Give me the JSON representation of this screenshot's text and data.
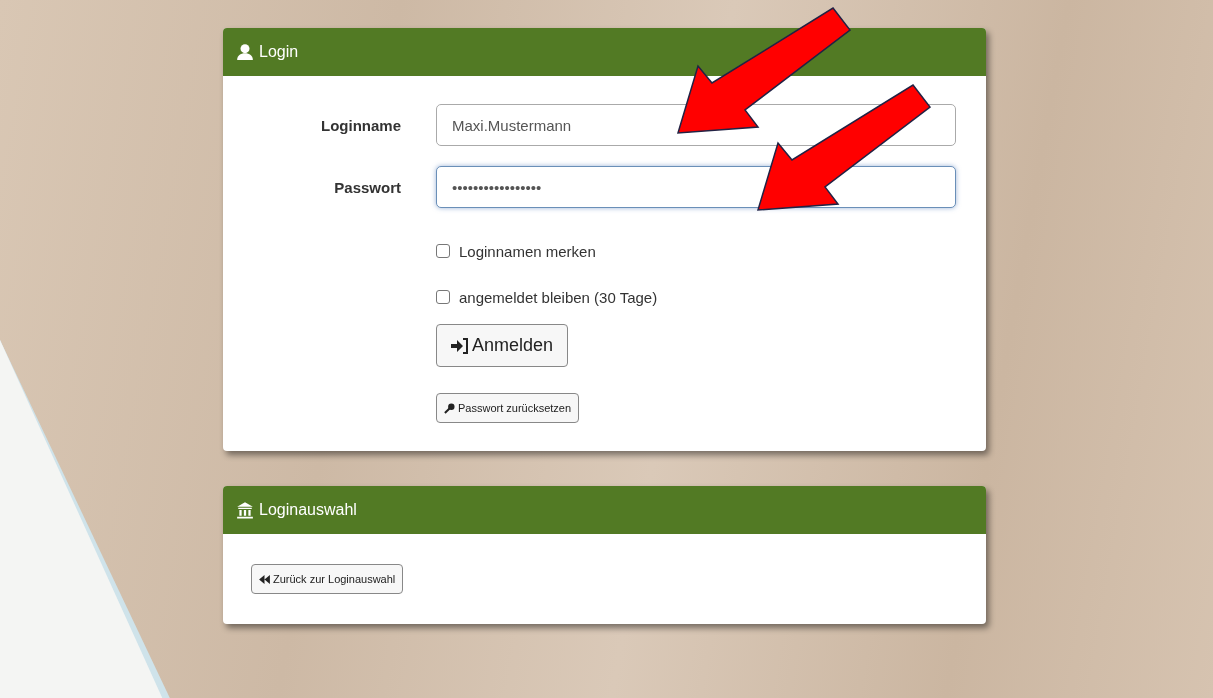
{
  "login_panel": {
    "title": "Login",
    "fields": [
      {
        "label": "Loginname",
        "value": "Maxi.Mustermann",
        "focused": false
      },
      {
        "label": "Passwort",
        "value": "•••••••••••••••••",
        "focused": true
      }
    ],
    "checkboxes": [
      {
        "label": "Loginnamen merken",
        "checked": false
      },
      {
        "label": "angemeldet bleiben (30 Tage)",
        "checked": false
      }
    ],
    "submit_button": "Anmelden",
    "reset_button": "Passwort zurücksetzen"
  },
  "selection_panel": {
    "title": "Loginauswahl",
    "back_button": "Zurück zur Loginauswahl"
  }
}
